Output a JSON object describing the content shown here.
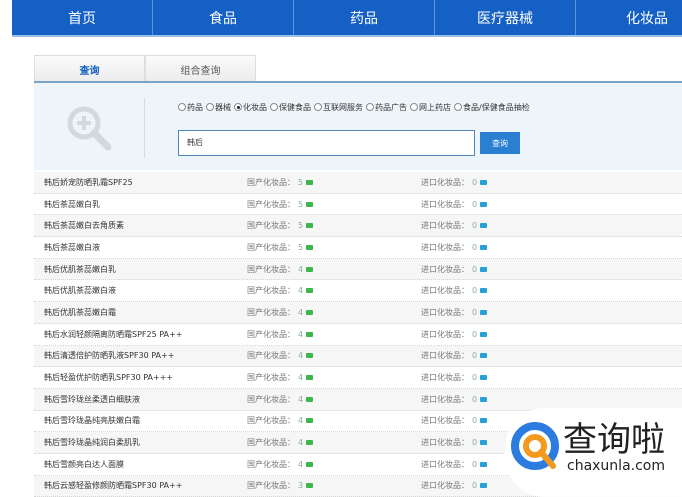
{
  "nav": [
    "首页",
    "食品",
    "药品",
    "医疗器械",
    "化妆品"
  ],
  "tabs": [
    "查询",
    "组合查询"
  ],
  "radios": [
    {
      "label": "药品",
      "checked": false
    },
    {
      "label": "器械",
      "checked": false
    },
    {
      "label": "化妆品",
      "checked": true
    },
    {
      "label": "保健食品",
      "checked": false
    },
    {
      "label": "互联网服务",
      "checked": false
    },
    {
      "label": "药品广告",
      "checked": false
    },
    {
      "label": "网上药店",
      "checked": false
    },
    {
      "label": "食品/保健食品抽检",
      "checked": false
    }
  ],
  "search": {
    "value": "韩后",
    "button": "查询"
  },
  "labels": {
    "domestic": "国产化妆品：",
    "imported": "进口化妆品："
  },
  "colors": {
    "nav": "#1560c4",
    "domestic_icon": "#3cb64a",
    "imported_icon": "#2a9fd6"
  },
  "rows": [
    {
      "name": "韩后娇宠防晒乳霜SPF25",
      "domestic": "5",
      "imported": "0"
    },
    {
      "name": "韩后茶蕊嫩白乳",
      "domestic": "5",
      "imported": "0"
    },
    {
      "name": "韩后茶蕊嫩白去角质素",
      "domestic": "5",
      "imported": "0"
    },
    {
      "name": "韩后茶蕊嫩白液",
      "domestic": "5",
      "imported": "0"
    },
    {
      "name": "韩后优肌茶蕊嫩白乳",
      "domestic": "4",
      "imported": "0"
    },
    {
      "name": "韩后优肌茶蕊嫩白液",
      "domestic": "4",
      "imported": "0"
    },
    {
      "name": "韩后优肌茶蕊嫩白霜",
      "domestic": "4",
      "imported": "0"
    },
    {
      "name": "韩后水润轻颜隔离防晒霜SPF25 PA++",
      "domestic": "4",
      "imported": "0"
    },
    {
      "name": "韩后清透倍护防晒乳液SPF30 PA++",
      "domestic": "4",
      "imported": "0"
    },
    {
      "name": "韩后轻盈优护防晒乳SPF30 PA+++",
      "domestic": "4",
      "imported": "0"
    },
    {
      "name": "韩后雪玲珑丝柔透白细肤液",
      "domestic": "4",
      "imported": "0"
    },
    {
      "name": "韩后雪玲珑晶纯亮肤嫩白霜",
      "domestic": "4",
      "imported": "0"
    },
    {
      "name": "韩后雪玲珑晶纯润白柔肌乳",
      "domestic": "4",
      "imported": "0"
    },
    {
      "name": "韩后雪颜亮白达人面膜",
      "domestic": "4",
      "imported": "0"
    },
    {
      "name": "韩后云感轻盈修颜防晒霜SPF30 PA++",
      "domestic": "3",
      "imported": "0"
    }
  ],
  "watermark": {
    "text": "查询啦",
    "url": "chaxunla.com"
  }
}
